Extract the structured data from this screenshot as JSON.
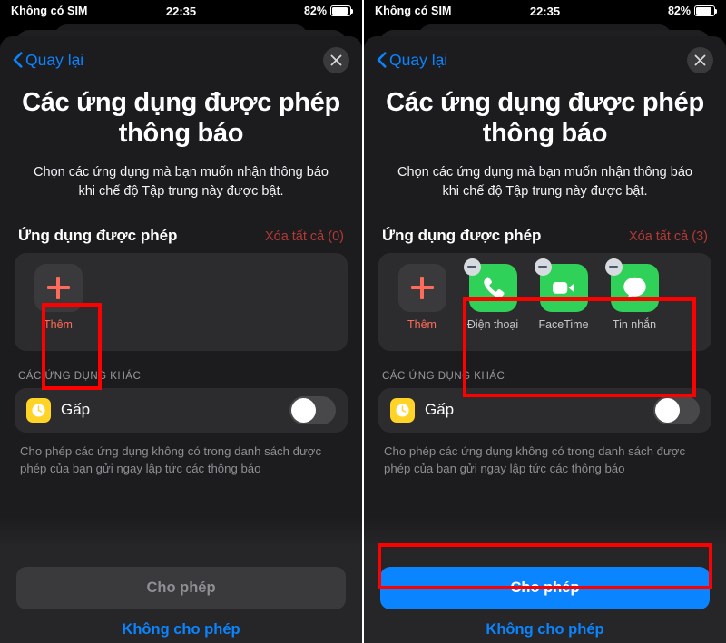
{
  "status_bar": {
    "carrier": "Không có SIM",
    "time": "22:35",
    "battery_percent": "82%"
  },
  "nav": {
    "back_label": "Quay lại",
    "back_icon": "chevron-left-icon",
    "close_icon": "close-icon"
  },
  "content": {
    "title": "Các ứng dụng được phép thông báo",
    "subtitle": "Chọn các ứng dụng mà bạn muốn nhận thông báo khi chế độ Tập trung này được bật.",
    "section_title": "Ứng dụng được phép",
    "other_apps_header": "CÁC ỨNG DỤNG KHÁC",
    "other_row": {
      "label": "Gấp",
      "icon": "clock-icon",
      "toggle_state": "off"
    },
    "footnote": "Cho phép các ứng dụng không có trong danh sách được phép của bạn gửi ngay lập tức các thông báo",
    "add_tile": {
      "label": "Thêm",
      "icon": "plus-icon"
    }
  },
  "left_panel": {
    "clear_all_label": "Xóa tất cả (0)",
    "allowed_apps": [],
    "primary_button": {
      "label": "Cho phép",
      "state": "disabled"
    },
    "secondary_button": {
      "label": "Không cho phép"
    }
  },
  "right_panel": {
    "clear_all_label": "Xóa tất cả (3)",
    "allowed_apps": [
      {
        "label": "Điện thoại",
        "icon": "phone-icon",
        "remove_icon": "minus-badge-icon"
      },
      {
        "label": "FaceTime",
        "icon": "video-camera-icon",
        "remove_icon": "minus-badge-icon"
      },
      {
        "label": "Tin nhắn",
        "icon": "message-bubble-icon",
        "remove_icon": "minus-badge-icon"
      }
    ],
    "primary_button": {
      "label": "Cho phép",
      "state": "enabled"
    },
    "secondary_button": {
      "label": "Không cho phép"
    }
  },
  "colors": {
    "accent_blue": "#0a84ff",
    "app_green": "#30d158",
    "destructive_red": "#b33a36",
    "add_red": "#ff6b5a",
    "annotation_red": "#ff0000",
    "sheet_background": "#1c1c1e",
    "card_background": "#2c2c2e",
    "time_sensitive_yellow": "#ffd426"
  }
}
